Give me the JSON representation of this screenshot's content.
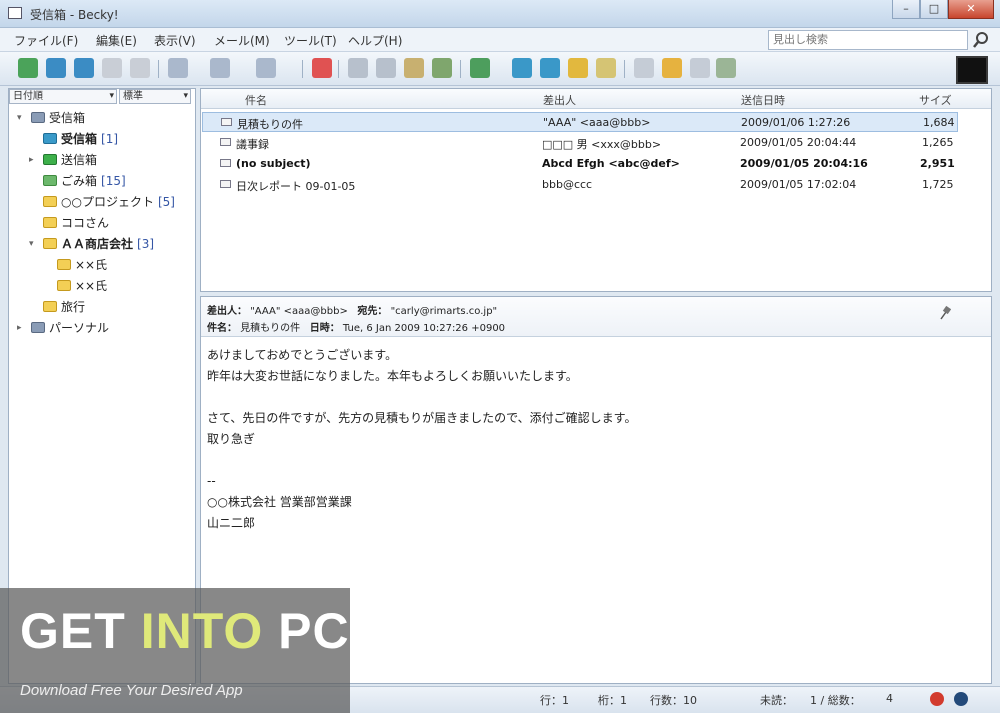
{
  "window": {
    "title": "受信箱 - Becky!",
    "buttons": [
      "–",
      "□",
      "✕"
    ]
  },
  "menu": [
    "ファイル(F)",
    "編集(E)",
    "表示(V)",
    "メール(M)",
    "ツール(T)",
    "ヘルプ(H)"
  ],
  "search": {
    "placeholder": "見出し検索"
  },
  "folders": {
    "selects": [
      "日付順",
      "標準"
    ],
    "tree": [
      {
        "label": "受信箱",
        "count": "",
        "icon": "mailbox-icon"
      },
      {
        "label": "受信箱",
        "count": "[1]",
        "icon": "inbox-icon"
      },
      {
        "label": "送信箱",
        "count": "",
        "icon": "outbox-icon"
      },
      {
        "label": "ごみ箱",
        "count": "[15]",
        "icon": "trash-icon"
      },
      {
        "label": "○○プロジェクト",
        "count": "[5]",
        "icon": "folder-icon"
      },
      {
        "label": "ココさん",
        "count": "",
        "icon": "folder-icon"
      },
      {
        "label": "ＡＡ商店会社",
        "count": "[3]",
        "icon": "folder-icon"
      },
      {
        "label": "××氏",
        "count": "",
        "icon": "folder-icon"
      },
      {
        "label": "××氏",
        "count": "",
        "icon": "folder-icon"
      },
      {
        "label": "旅行",
        "count": "",
        "icon": "folder-icon"
      },
      {
        "label": "パーソナル",
        "count": "",
        "icon": "mailbox-icon"
      }
    ]
  },
  "list": {
    "headers": [
      "件名",
      "差出人",
      "送信日時",
      "サイズ"
    ],
    "rows": [
      {
        "subject": "見積もりの件",
        "from": "\"AAA\" <aaa@bbb>",
        "date": "2009/01/06 1:27:26",
        "size": "1,684"
      },
      {
        "subject": "議事録",
        "from": "□□□ 男 <xxx@bbb>",
        "date": "2009/01/05 20:04:44",
        "size": "1,265"
      },
      {
        "subject": "(no subject)",
        "from": "Abcd Efgh <abc@def>",
        "date": "2009/01/05 20:04:16",
        "size": "2,951"
      },
      {
        "subject": "日次レポート 09-01-05",
        "from": "bbb@ccc",
        "date": "2009/01/05 17:02:04",
        "size": "1,725"
      }
    ]
  },
  "preview": {
    "from_label": "差出人：",
    "from": "\"AAA\" <aaa@bbb>",
    "to_label": "宛先：",
    "to": "\"carly@rimarts.co.jp\"",
    "subject_label": "件名：",
    "subject": "見積もりの件",
    "date_label": "日時：",
    "date": "Tue, 6 Jan 2009 10:27:26 +0900",
    "body": "あけましておめでとうございます。\n昨年は大変お世話になりました。本年もよろしくお願いいたします。\n\nさて、先日の件ですが、先方の見積もりが届きましたので、添付ご確認します。\n取り急ぎ\n\n--\n○○株式会社 営業部営業課\n山ニ二郎"
  },
  "status": {
    "line": "行：1",
    "col": "桁：1",
    "lines": "行数：10",
    "unread": "未読：",
    "unread_val": "1 / 総数：",
    "total": "4"
  },
  "watermark": {
    "title_a": "GET ",
    "title_b": "INTO",
    "title_c": " PC",
    "subtitle": "Download Free Your Desired App"
  }
}
